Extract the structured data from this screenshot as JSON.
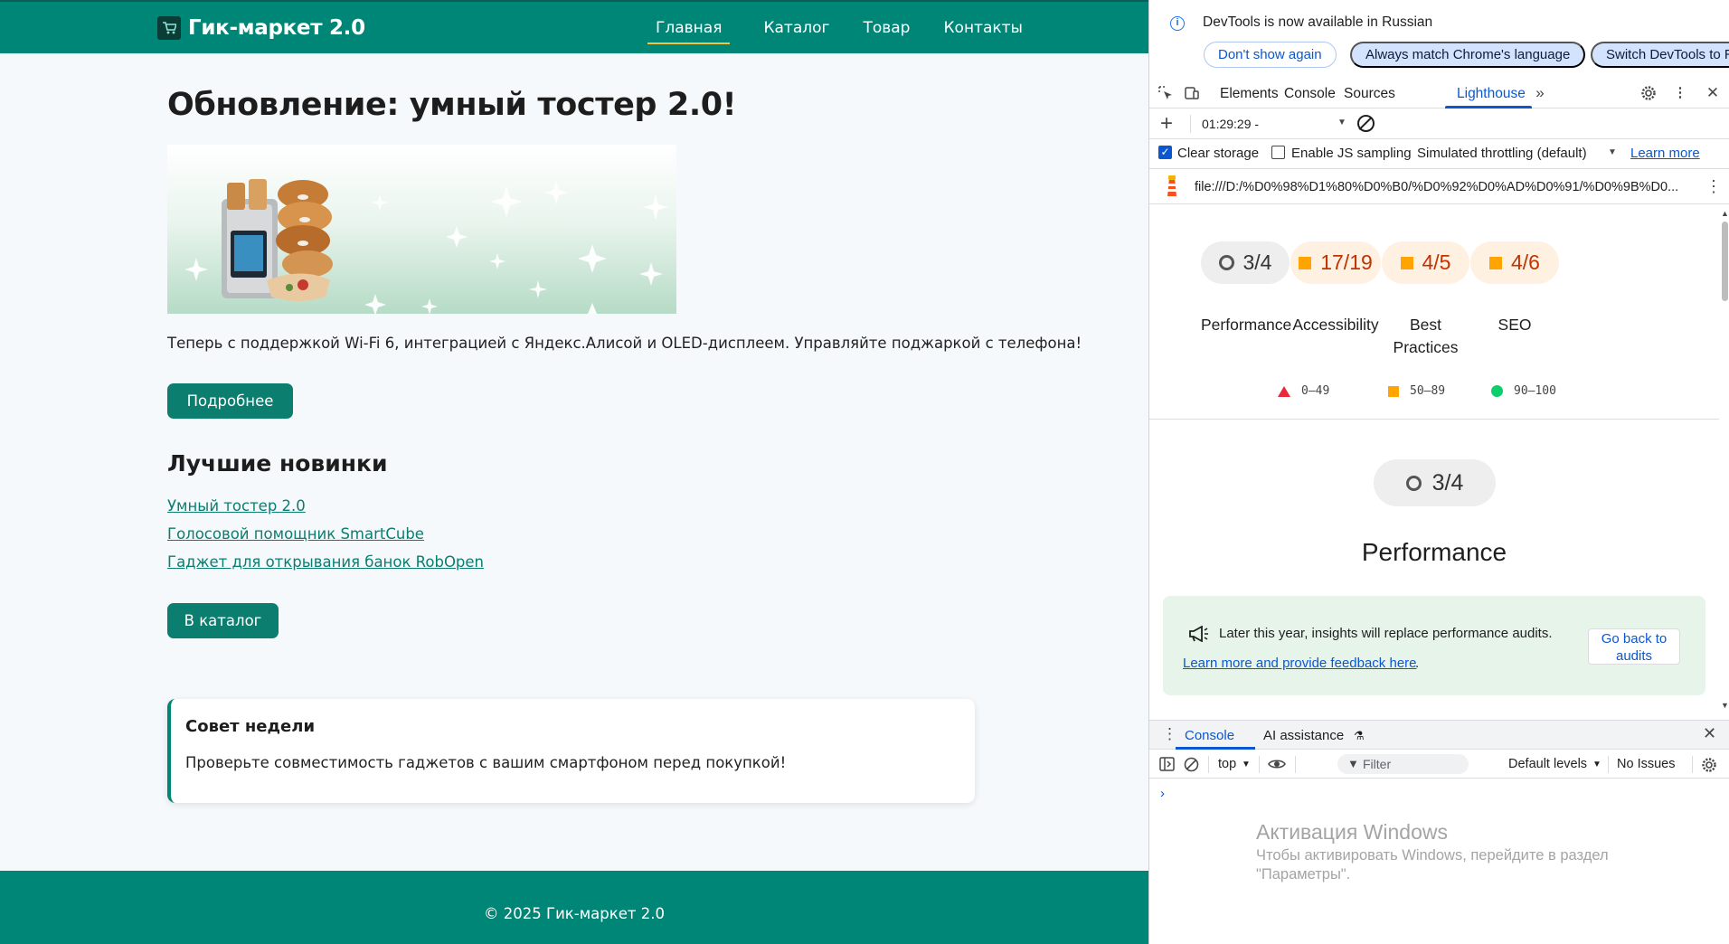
{
  "site": {
    "logo_text": "Гик-маркет 2.0",
    "nav": [
      {
        "label": "Главная",
        "active": true
      },
      {
        "label": "Каталог",
        "active": false
      },
      {
        "label": "Товар",
        "active": false
      },
      {
        "label": "Контакты",
        "active": false
      }
    ],
    "hero_title": "Обновление: умный тостер 2.0!",
    "hero_text": "Теперь с поддержкой Wi-Fi 6, интеграцией с Яндекс.Алисой и OLED-дисплеем. Управляйте поджаркой с телефона!",
    "more_button": "Подробнее",
    "new_title": "Лучшие новинки",
    "new_items": [
      "Умный тостер 2.0",
      "Голосовой помощник SmartCube",
      "Гаджет для открывания банок RobOpen"
    ],
    "catalog_button": "В каталог",
    "tip_title": "Совет недели",
    "tip_text": "Проверьте совместимость гаджетов с вашим смартфоном перед покупкой!",
    "footer": "© 2025 Гик-маркет 2.0",
    "colors": {
      "primary": "#008677",
      "accent_underline": "#f3c443"
    }
  },
  "devtools": {
    "infobar": {
      "text": "DevTools is now available in Russian",
      "dont_show": "Don't show again",
      "always_match": "Always match Chrome's language",
      "switch": "Switch DevTools to R"
    },
    "tabs": [
      "Elements",
      "Console",
      "Sources",
      "Lighthouse"
    ],
    "active_tab": "Lighthouse",
    "lighthouse": {
      "report_time": "01:29:29 -",
      "clear_storage": "Clear storage",
      "enable_js_sampling": "Enable JS sampling",
      "throttling": "Simulated throttling (default)",
      "learn_more": "Learn more",
      "url": "file:///D:/%D0%98%D1%80%D0%B0/%D0%92%D0%AD%D0%91/%D0%9B%D0...",
      "scores": [
        {
          "value": "3/4",
          "label": "Performance",
          "kind": "gray"
        },
        {
          "value": "17/19",
          "label": "Accessibility",
          "kind": "orange"
        },
        {
          "value": "4/5",
          "label": "Best Practices",
          "kind": "orange"
        },
        {
          "value": "4/6",
          "label": "SEO",
          "kind": "orange"
        }
      ],
      "legend": [
        "0–49",
        "50–89",
        "90–100"
      ],
      "perf_score": "3/4",
      "perf_title": "Performance",
      "insights_msg": "Later this year, insights will replace performance audits.",
      "insights_link": "Learn more and provide feedback here",
      "back_button": "Go back to audits"
    },
    "drawer": {
      "tabs": [
        "Console",
        "AI assistance"
      ],
      "context": "top",
      "filter_placeholder": "Filter",
      "levels": "Default levels",
      "issues": "No Issues"
    }
  },
  "os_overlay": {
    "title": "Активация Windows",
    "text": "Чтобы активировать Windows, перейдите в раздел \"Параметры\"."
  }
}
